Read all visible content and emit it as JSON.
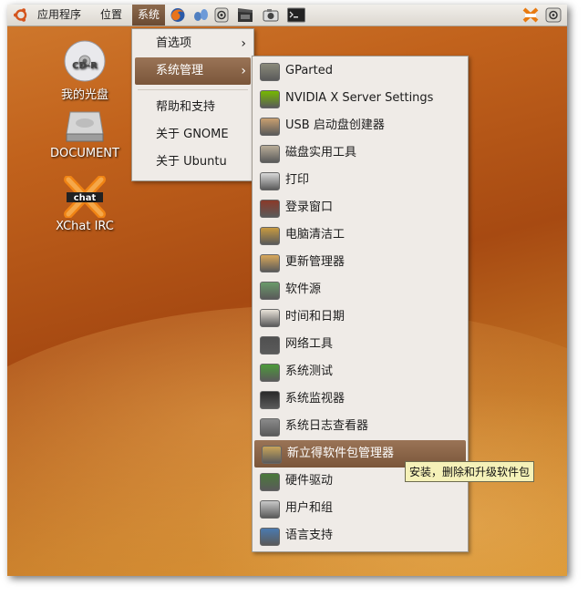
{
  "panel": {
    "menus": [
      "应用程序",
      "位置",
      "系统"
    ],
    "launchers": [
      "firefox-icon",
      "pidgin-icon",
      "audio-icon",
      "movie-icon",
      "screenshot-icon",
      "terminal-icon"
    ],
    "tray": [
      "xchat-tray-icon",
      "volume-icon"
    ]
  },
  "desktop": {
    "icons": [
      {
        "label": "我的光盘",
        "badge": "CD-R"
      },
      {
        "label": "DOCUMENT"
      },
      {
        "label": "XChat IRC",
        "badge": "chat"
      }
    ]
  },
  "system_menu": {
    "items": [
      {
        "label": "首选项",
        "submenu": true
      },
      {
        "label": "系统管理",
        "submenu": true,
        "active": true
      },
      {
        "label": "帮助和支持"
      },
      {
        "label": "关于 GNOME"
      },
      {
        "label": "关于 Ubuntu"
      }
    ],
    "arrow": "›"
  },
  "admin_menu": {
    "items": [
      {
        "label": "GParted",
        "icon": "gparted-icon",
        "color": "#8a8a7a"
      },
      {
        "label": "NVIDIA X Server Settings",
        "icon": "nvidia-icon",
        "color": "#76b900"
      },
      {
        "label": "USB 启动盘创建器",
        "icon": "usb-creator-icon",
        "color": "#c9a070"
      },
      {
        "label": "磁盘实用工具",
        "icon": "disk-utility-icon",
        "color": "#b9ad98"
      },
      {
        "label": "打印",
        "icon": "printer-icon",
        "color": "#d8d8d8"
      },
      {
        "label": "登录窗口",
        "icon": "login-window-icon",
        "color": "#8a3a2a"
      },
      {
        "label": "电脑清洁工",
        "icon": "broom-icon",
        "color": "#c89a40"
      },
      {
        "label": "更新管理器",
        "icon": "update-manager-icon",
        "color": "#d9a85a"
      },
      {
        "label": "软件源",
        "icon": "software-sources-icon",
        "color": "#6a9a6a"
      },
      {
        "label": "时间和日期",
        "icon": "calendar-icon",
        "color": "#e8e2d8"
      },
      {
        "label": "网络工具",
        "icon": "network-tools-icon",
        "color": "#505050"
      },
      {
        "label": "系统测试",
        "icon": "system-testing-icon",
        "color": "#4c9a3a"
      },
      {
        "label": "系统监视器",
        "icon": "system-monitor-icon",
        "color": "#2a2a2a"
      },
      {
        "label": "系统日志查看器",
        "icon": "log-viewer-icon",
        "color": "#8a8a8a"
      },
      {
        "label": "新立得软件包管理器",
        "icon": "synaptic-icon",
        "color": "#c9a55a",
        "active": true
      },
      {
        "label": "硬件驱动",
        "icon": "hardware-drivers-icon",
        "color": "#4a7a3a"
      },
      {
        "label": "用户和组",
        "icon": "users-groups-icon",
        "color": "#c8c8c8"
      },
      {
        "label": "语言支持",
        "icon": "language-support-icon",
        "color": "#4a7ab0"
      }
    ]
  },
  "tooltip": {
    "text": "安装，删除和升级软件包"
  }
}
